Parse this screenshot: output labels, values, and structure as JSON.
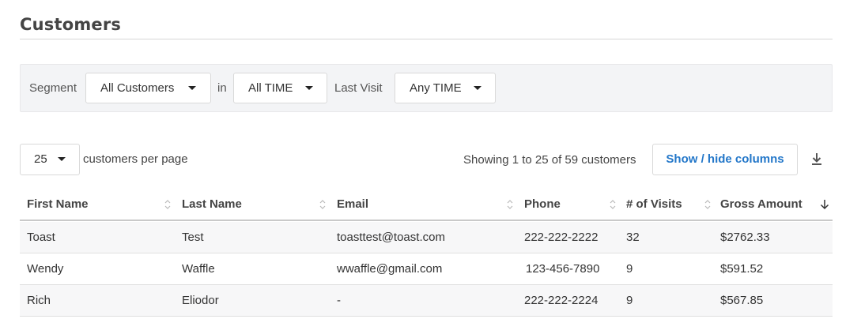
{
  "page": {
    "title": "Customers"
  },
  "filters": {
    "segment_label": "Segment",
    "segment_value": "All Customers",
    "in_label": "in",
    "time_value": "All TIME",
    "last_visit_label": "Last Visit",
    "last_visit_value": "Any TIME"
  },
  "pagination": {
    "per_page_value": "25",
    "per_page_label": "customers per page",
    "showing_text": "Showing 1 to 25 of 59 customers"
  },
  "toolbar": {
    "columns_button_label": "Show / hide columns",
    "download_icon": "download-icon"
  },
  "table": {
    "columns": [
      "First Name",
      "Last Name",
      "Email",
      "Phone",
      "# of Visits",
      "Gross Amount"
    ],
    "rows": [
      [
        "Toast",
        "Test",
        "toasttest@toast.com",
        "222-222-2222",
        "32",
        "$2762.33"
      ],
      [
        "Wendy",
        "Waffle",
        "wwaffle@gmail.com",
        "123-456-7890",
        "9",
        "$591.52"
      ],
      [
        "Rich",
        "Eliodor",
        "-",
        "222-222-2224",
        "9",
        "$567.85"
      ]
    ]
  },
  "colors": {
    "accent": "#2377c9",
    "filter_bg": "#f3f4f6"
  }
}
